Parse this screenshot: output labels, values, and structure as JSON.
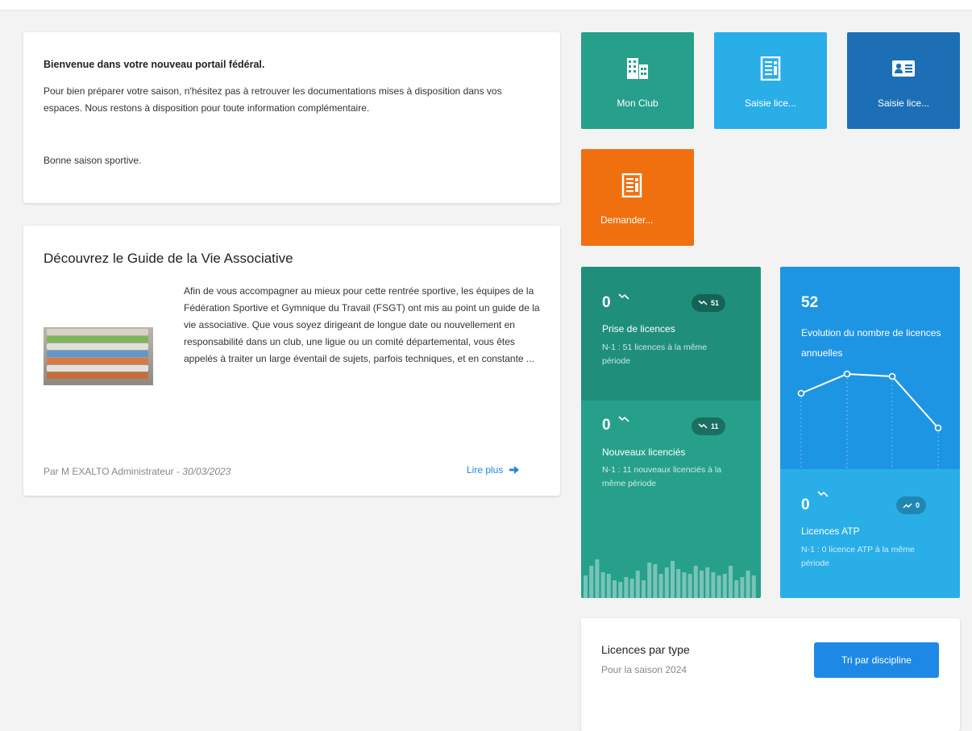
{
  "welcome": {
    "title": "Bienvenue dans votre nouveau portail fédéral.",
    "body": "Pour bien préparer votre saison, n'hésitez pas à retrouver les documentations mises à disposition dans vos espaces. Nous restons à disposition pour toute information complémentaire.",
    "closing": "Bonne saison sportive."
  },
  "article": {
    "title": "Découvrez le Guide de la Vie Associative",
    "excerpt": "Afin de vous accompagner au mieux pour cette rentrée sportive, les équipes de la Fédération Sportive et Gymnique du Travail (FSGT) ont mis au point un guide de la vie associative.  Que vous soyez dirigeant de longue date ou nouvellement en responsabilité dans un club, une ligue ou un comité départemental, vous êtes appelés à traiter un large éventail de sujets, parfois techniques, et en constante ...",
    "author": "Par M EXALTO Administrateur - ",
    "date": "30/03/2023",
    "read_more": "Lire plus",
    "image_icon": "binders-stack-image"
  },
  "tiles": [
    {
      "label": "Mon Club",
      "icon": "building-icon",
      "color": "#26a08b"
    },
    {
      "label": "Saisie lice...",
      "icon": "document-icon",
      "color": "#29aee8"
    },
    {
      "label": "Saisie lice...",
      "icon": "id-card-icon",
      "color": "#1c6fb5"
    },
    {
      "label": "Demander...",
      "icon": "document-icon",
      "color": "#f07010"
    }
  ],
  "stats": {
    "prise": {
      "value": "0",
      "pill": "51",
      "label": "Prise de licences",
      "sub": "N-1 : 51 licences à la même période"
    },
    "nouveaux": {
      "value": "0",
      "pill": "11",
      "label": "Nouveaux licenciés",
      "sub": "N-1 : 11 nouveaux licenciés à la même période"
    },
    "evolution": {
      "value": "52",
      "label": "Evolution du nombre de licences annuelles"
    },
    "atp": {
      "value": "0",
      "pill": "0",
      "label": "Licences ATP",
      "sub": "N-1 : 0 licence ATP à la même période"
    }
  },
  "type_card": {
    "title": "Licences par type",
    "subtitle": "Pour la saison 2024",
    "button": "Tri par discipline"
  },
  "colors": {
    "green": "#26a08b",
    "dark_green": "#1f8f7c",
    "light_blue": "#29aee8",
    "blue": "#1e95e3",
    "dark_blue": "#1c6fb5",
    "orange": "#f07010",
    "link": "#1e88e5"
  }
}
